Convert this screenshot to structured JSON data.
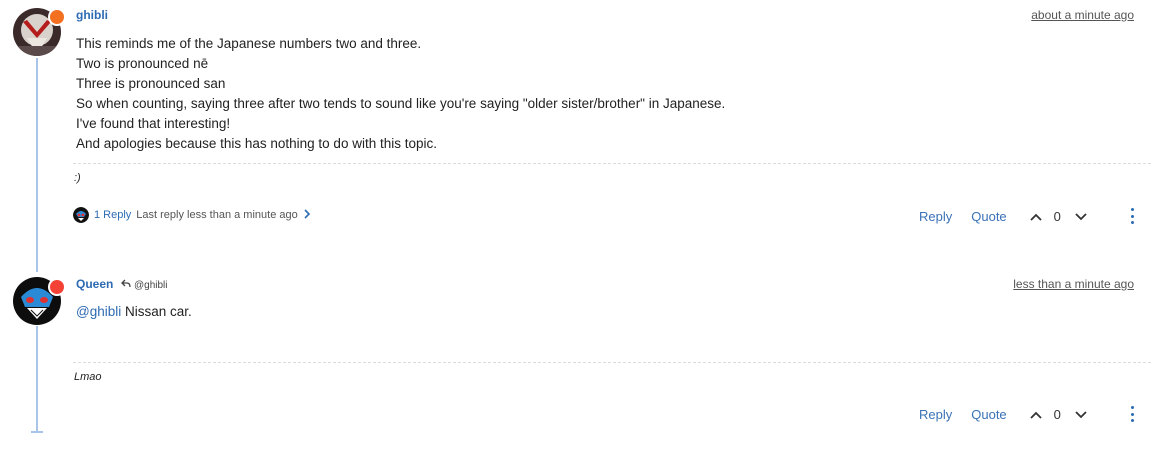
{
  "posts": [
    {
      "username": "ghibli",
      "timestamp": "about a minute ago",
      "status_color": "#f37021",
      "content_lines": [
        "This reminds me of the Japanese numbers two and three.",
        "Two is pronounced nē",
        "Three is pronounced san",
        "So when counting, saying three after two tends to sound like you're saying \"older sister/brother\" in Japanese.",
        "I've found that interesting!",
        "And apologies because this has nothing to do with this topic."
      ],
      "signature": ":)",
      "replies": {
        "count_label": "1 Reply",
        "last_reply": "Last reply less than a minute ago"
      },
      "actions": {
        "reply": "Reply",
        "quote": "Quote",
        "votes": "0"
      }
    },
    {
      "username": "Queen",
      "reply_to": "@ghibli",
      "timestamp": "less than a minute ago",
      "status_color": "#f44336",
      "mention": "@ghibli",
      "content_text": " Nissan car.",
      "signature": "Lmao",
      "actions": {
        "reply": "Reply",
        "quote": "Quote",
        "votes": "0"
      }
    }
  ],
  "colors": {
    "link": "#2d6bb3",
    "timeline": "#a8c4e8"
  }
}
